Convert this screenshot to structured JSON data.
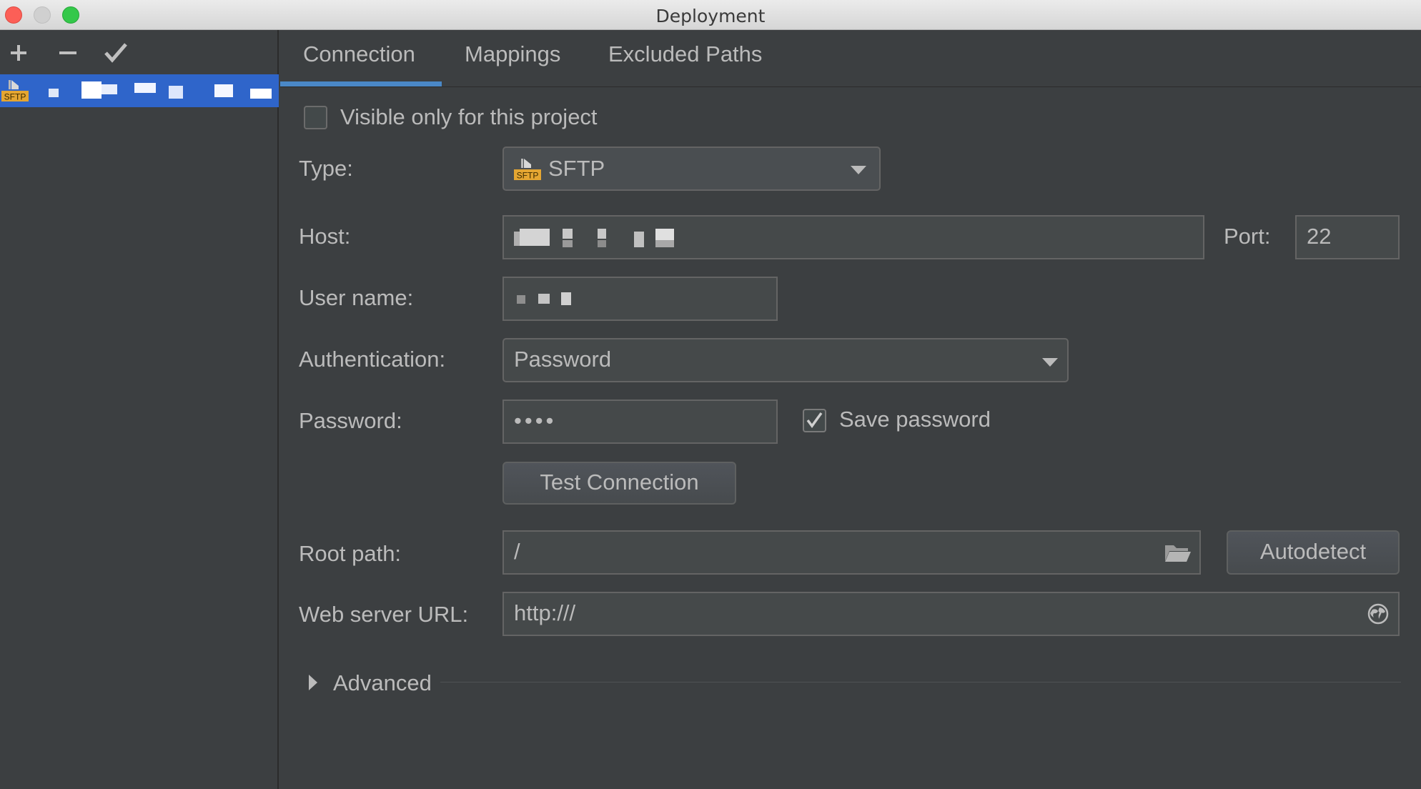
{
  "window": {
    "title": "Deployment"
  },
  "colors": {
    "accent": "#2f65ca",
    "tab_underline": "#4a88c7",
    "sftp_badge": "#e5a632"
  },
  "toolbar": {
    "add_icon": "plus-icon",
    "remove_icon": "minus-icon",
    "apply_icon": "checkmark-icon"
  },
  "server_list": {
    "items": [
      {
        "type_badge": "SFTP"
      }
    ]
  },
  "tabs": [
    {
      "label": "Connection"
    },
    {
      "label": "Mappings"
    },
    {
      "label": "Excluded Paths"
    }
  ],
  "form": {
    "visible_only_label": "Visible only for this project",
    "visible_only_checked": false,
    "type_label": "Type:",
    "type_value": "SFTP",
    "type_badge": "SFTP",
    "host_label": "Host:",
    "port_label": "Port:",
    "port_value": "22",
    "username_label": "User name:",
    "auth_label": "Authentication:",
    "auth_value": "Password",
    "password_label": "Password:",
    "password_value": "••••",
    "save_password_label": "Save password",
    "save_password_checked": true,
    "test_connection_label": "Test Connection",
    "root_path_label": "Root path:",
    "root_path_value": "/",
    "autodetect_label": "Autodetect",
    "web_url_label": "Web server URL:",
    "web_url_value": "http:///",
    "advanced_label": "Advanced"
  }
}
